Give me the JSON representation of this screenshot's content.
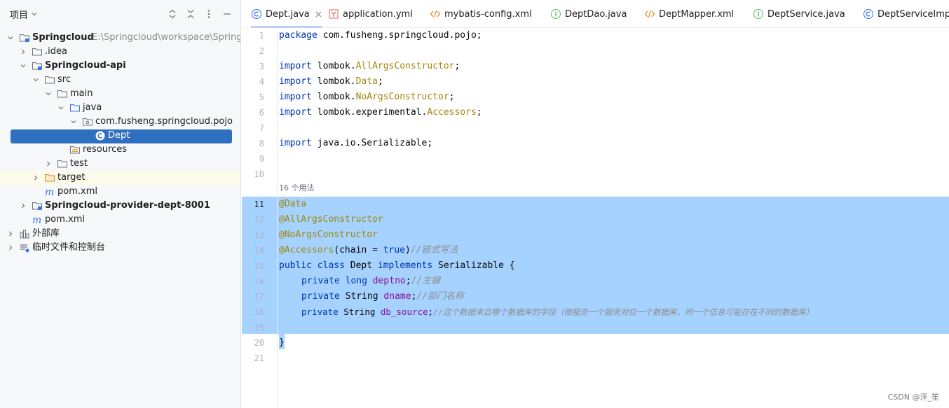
{
  "project_panel": {
    "title": "项目",
    "tree": [
      {
        "label": "Springcloud",
        "path": "E:\\Springcloud\\workspace\\Springcloud",
        "bold": true
      },
      {
        "label": ".idea"
      },
      {
        "label": "Springcloud-api",
        "bold": true
      },
      {
        "label": "src"
      },
      {
        "label": "main"
      },
      {
        "label": "java"
      },
      {
        "label": "com.fusheng.springcloud.pojo"
      },
      {
        "label": "Dept",
        "selected": true
      },
      {
        "label": "resources"
      },
      {
        "label": "test"
      },
      {
        "label": "target"
      },
      {
        "label": "pom.xml"
      },
      {
        "label": "Springcloud-provider-dept-8001",
        "bold": true
      },
      {
        "label": "pom.xml"
      },
      {
        "label": "外部库"
      },
      {
        "label": "临时文件和控制台"
      }
    ]
  },
  "tabs": [
    {
      "label": "Dept.java",
      "active": true
    },
    {
      "label": "application.yml"
    },
    {
      "label": "mybatis-config.xml"
    },
    {
      "label": "DeptDao.java"
    },
    {
      "label": "DeptMapper.xml"
    },
    {
      "label": "DeptService.java"
    },
    {
      "label": "DeptServiceImpl"
    }
  ],
  "editor": {
    "line_numbers": [
      "1",
      "2",
      "3",
      "4",
      "5",
      "6",
      "7",
      "8",
      "9",
      "10",
      "11",
      "12",
      "13",
      "14",
      "15",
      "16",
      "17",
      "18",
      "19",
      "20",
      "21"
    ],
    "usage_hint": "16 个用法",
    "code": {
      "l1_kw": "package",
      "l1_rest": " com.fusheng.springcloud.pojo;",
      "import": "import",
      "l3_pkg": " lombok.",
      "l3_ann": "AllArgsConstructor",
      "semi": ";",
      "l4_ann": "Data",
      "l5_ann": "NoArgsConstructor",
      "l6_pkg": " lombok.experimental.",
      "l6_ann": "Accessors",
      "l8_rest": " java.io.Serializable;",
      "a_data": "@Data",
      "a_all": "@AllArgsConstructor",
      "a_no": "@NoArgsConstructor",
      "a_acc": "@Accessors",
      "l14_open": "(chain = ",
      "l14_true": "true",
      "l14_close": ")",
      "l14_cm": "//链式写法",
      "public": "public",
      "class": " class",
      "l15_name": " Dept ",
      "implements": "implements",
      "l15_rest": " Serializable {",
      "private": "private",
      "long": " long ",
      "string": " String ",
      "f_deptno": "deptno",
      "cm_deptno": "//主键",
      "f_dname": "dname",
      "cm_dname": "//部门名称",
      "f_db": "db_source",
      "cm_db": "//这个数据来自哪个数据库的字段（微服务一个服务对应一个数据库，同一个信息可能存在不同的数据库）",
      "close": "}"
    }
  },
  "watermark": "CSDN @浮_笙",
  "colors": {
    "accent": "#3574f0",
    "selection": "#a6d2ff",
    "tree_selection": "#2f6fbf"
  }
}
